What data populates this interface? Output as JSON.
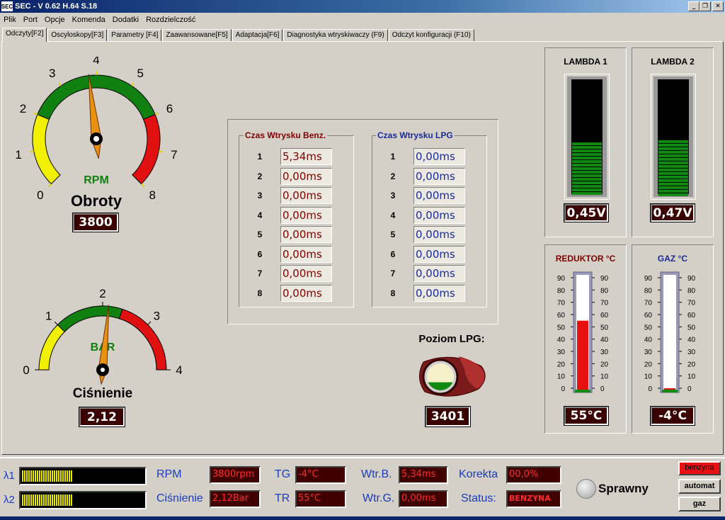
{
  "window": {
    "title": "SEC - V 0.62 H.64 S.18",
    "icon": "SEC",
    "min": "_",
    "max": "❐",
    "close": "✕"
  },
  "menu": [
    "Plik",
    "Port",
    "Opcje",
    "Komenda",
    "Dodatki",
    "Rozdzielczość"
  ],
  "tabs": [
    "Odczyty[F2]",
    "Oscyloskopy[F3]",
    "Parametry [F4]",
    "Zaawansowane[F5]",
    "Adaptacja[F6]",
    "Diagnostyka wtryskiwaczy (F9)",
    "Odczyt konfiguracji (F10)"
  ],
  "rpm_gauge": {
    "ticks": [
      "0",
      "1",
      "2",
      "3",
      "4",
      "5",
      "6",
      "7",
      "8"
    ],
    "unit_label": "RPM",
    "caption": "Obroty",
    "value": "3800",
    "value_fraction": 0.475
  },
  "pressure_gauge": {
    "ticks": [
      "0",
      "1",
      "2",
      "3",
      "4"
    ],
    "unit_label": "BAR",
    "caption": "Ciśnienie",
    "value": "2,12",
    "value_fraction": 0.53
  },
  "injection": {
    "petrol": {
      "title": "Czas Wtrysku Benz.",
      "rows": [
        {
          "n": "1",
          "v": "5,34ms"
        },
        {
          "n": "2",
          "v": "0,00ms"
        },
        {
          "n": "3",
          "v": "0,00ms"
        },
        {
          "n": "4",
          "v": "0,00ms"
        },
        {
          "n": "5",
          "v": "0,00ms"
        },
        {
          "n": "6",
          "v": "0,00ms"
        },
        {
          "n": "7",
          "v": "0,00ms"
        },
        {
          "n": "8",
          "v": "0,00ms"
        }
      ]
    },
    "lpg": {
      "title": "Czas Wtrysku LPG",
      "rows": [
        {
          "n": "1",
          "v": "0,00ms"
        },
        {
          "n": "2",
          "v": "0,00ms"
        },
        {
          "n": "3",
          "v": "0,00ms"
        },
        {
          "n": "4",
          "v": "0,00ms"
        },
        {
          "n": "5",
          "v": "0,00ms"
        },
        {
          "n": "6",
          "v": "0,00ms"
        },
        {
          "n": "7",
          "v": "0,00ms"
        },
        {
          "n": "8",
          "v": "0,00ms"
        }
      ]
    }
  },
  "lpg_level": {
    "label": "Poziom LPG:",
    "value": "3401",
    "fill_fraction": 0.3
  },
  "lambda1": {
    "title": "LAMBDA 1",
    "value": "0,45V",
    "fill_fraction": 0.45
  },
  "lambda2": {
    "title": "LAMBDA 2",
    "value": "0,47V",
    "fill_fraction": 0.47
  },
  "reducer": {
    "title": "REDUKTOR °C",
    "value": "55°C",
    "level": 55,
    "ticks": [
      "90",
      "80",
      "70",
      "60",
      "50",
      "40",
      "30",
      "20",
      "10",
      "0"
    ]
  },
  "gas": {
    "title": "GAZ °C",
    "value": "-4°C",
    "level": -4,
    "ticks": [
      "90",
      "80",
      "70",
      "60",
      "50",
      "40",
      "30",
      "20",
      "10",
      "0"
    ]
  },
  "status": {
    "l1": "λ1",
    "l2": "λ2",
    "l1_fraction": 0.42,
    "l2_fraction": 0.42,
    "rpm_label": "RPM",
    "rpm_value": "3800rpm",
    "press_label": "Ciśnienie",
    "press_value": "2,12Bar",
    "tg_label": "TG",
    "tg_value": "-4°C",
    "tr_label": "TR",
    "tr_value": "55°C",
    "wtrb_label": "Wtr.B.",
    "wtrb_value": "5,34ms",
    "wtrg_label": "Wtr.G.",
    "wtrg_value": "0,00ms",
    "kor_label": "Korekta",
    "kor_value": "00,0%",
    "stat_label": "Status:",
    "stat_value": "BENZYNA",
    "ok_label": "Sprawny",
    "btn_benzyna": "benzyna",
    "btn_automat": "automat",
    "btn_gaz": "gaz"
  },
  "colors": {
    "green": "#108010",
    "yellow": "#f0f000",
    "red": "#e01010",
    "needle": "#e89010",
    "led_bg": "#3a0000"
  }
}
